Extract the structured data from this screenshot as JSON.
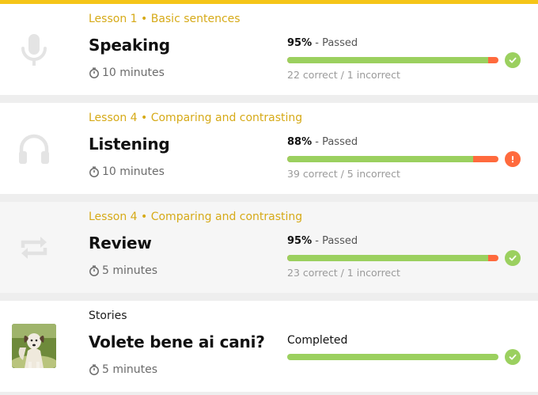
{
  "colors": {
    "accent": "#f5c518",
    "lesson_text": "#d6aa18",
    "correct": "#9bd05f",
    "incorrect": "#ff6a3d"
  },
  "activities": [
    {
      "lesson": "Lesson 1 • Basic sentences",
      "title": "Speaking",
      "icon": "microphone-icon",
      "duration": "10 minutes",
      "score": "95%",
      "status_text": "- Passed",
      "counts": "22 correct / 1 incorrect",
      "progress_correct_pct": 95,
      "status_icon": "check-icon"
    },
    {
      "lesson": "Lesson 4 • Comparing and contrasting",
      "title": "Listening",
      "icon": "headphones-icon",
      "duration": "10 minutes",
      "score": "88%",
      "status_text": "- Passed",
      "counts": "39 correct / 5 incorrect",
      "progress_correct_pct": 88,
      "status_icon": "exclamation-icon"
    },
    {
      "lesson": "Lesson 4 • Comparing and contrasting",
      "title": "Review",
      "icon": "repeat-icon",
      "duration": "5 minutes",
      "score": "95%",
      "status_text": "- Passed",
      "counts": "23 correct / 1 incorrect",
      "progress_correct_pct": 95,
      "status_icon": "check-icon"
    },
    {
      "lesson": "Stories",
      "title": "Volete bene ai cani?",
      "icon": "dog-photo",
      "duration": "5 minutes",
      "status_text": "Completed",
      "progress_correct_pct": 100,
      "status_icon": "check-icon"
    }
  ]
}
